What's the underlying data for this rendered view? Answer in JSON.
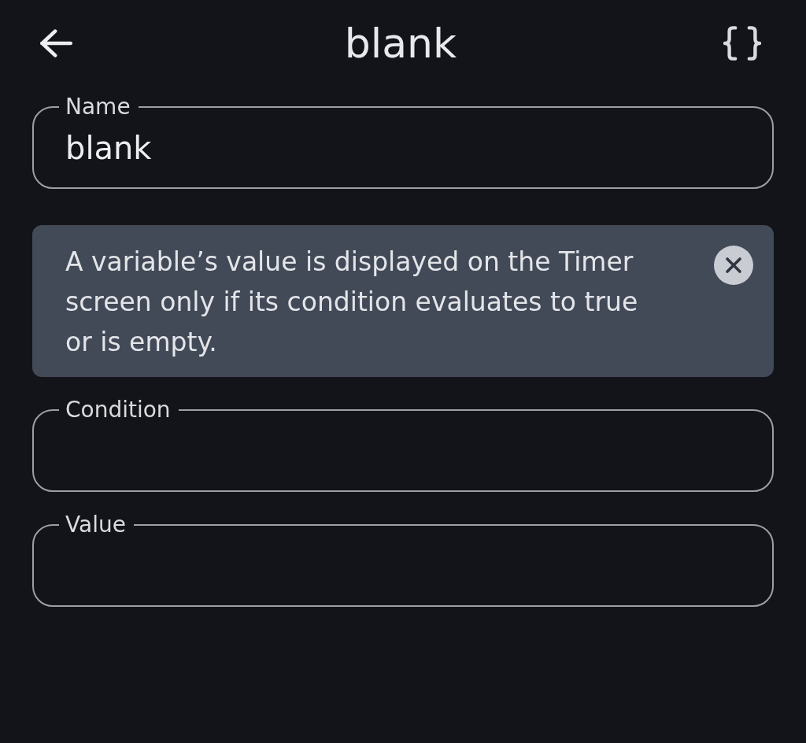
{
  "header": {
    "title": "blank"
  },
  "form": [
    {
      "kind": "field",
      "label": "Name",
      "value": "blank"
    },
    {
      "kind": "banner",
      "text": "A variable’s value is displayed on the Timer screen only if its condition evaluates to true or is empty."
    },
    {
      "kind": "field",
      "label": "Condition"
    },
    {
      "kind": "field",
      "label": "Value"
    }
  ]
}
